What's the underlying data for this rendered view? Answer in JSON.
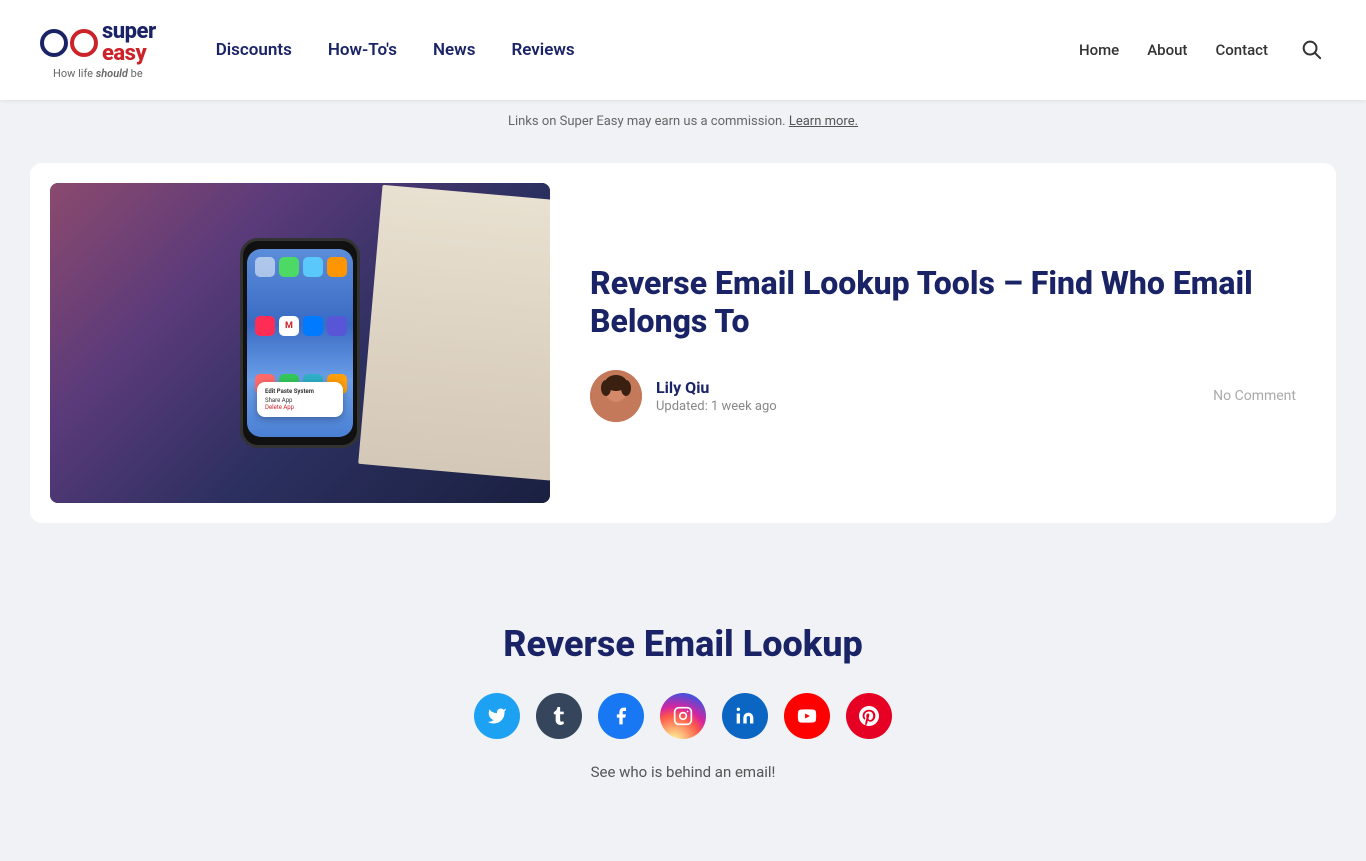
{
  "header": {
    "logo": {
      "super": "super",
      "easy": "easy",
      "tagline": "How life should be"
    },
    "main_nav": [
      {
        "label": "Discounts",
        "href": "#"
      },
      {
        "label": "How-To's",
        "href": "#"
      },
      {
        "label": "News",
        "href": "#"
      },
      {
        "label": "Reviews",
        "href": "#"
      }
    ],
    "secondary_nav": [
      {
        "label": "Home",
        "href": "#"
      },
      {
        "label": "About",
        "href": "#"
      },
      {
        "label": "Contact",
        "href": "#"
      }
    ],
    "search_aria": "Search"
  },
  "notice_bar": {
    "text": "Links on Super Easy may earn us a commission.",
    "link_text": "Learn more."
  },
  "article": {
    "title": "Reverse Email Lookup Tools – Find Who Email Belongs To",
    "author_name": "Lily Qiu",
    "updated": "Updated: 1 week ago",
    "no_comment": "No Comment"
  },
  "lookup_section": {
    "title": "Reverse Email Lookup",
    "description": "See who is behind an email!",
    "social_icons": [
      {
        "name": "twitter",
        "label": "T",
        "class": "si-twitter"
      },
      {
        "name": "tumblr",
        "label": "t",
        "class": "si-tumblr"
      },
      {
        "name": "facebook",
        "label": "f",
        "class": "si-facebook"
      },
      {
        "name": "instagram",
        "label": "⊙",
        "class": "si-instagram"
      },
      {
        "name": "linkedin",
        "label": "in",
        "class": "si-linkedin"
      },
      {
        "name": "youtube",
        "label": "▶",
        "class": "si-youtube"
      },
      {
        "name": "pinterest",
        "label": "P",
        "class": "si-pinterest"
      }
    ]
  }
}
